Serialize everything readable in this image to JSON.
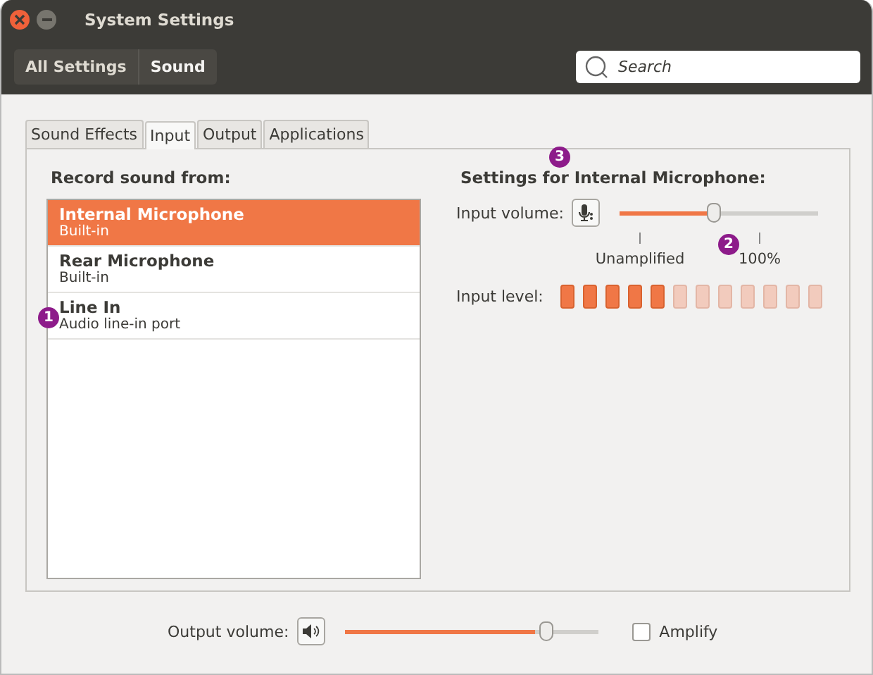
{
  "window": {
    "title": "System Settings"
  },
  "breadcrumbs": [
    {
      "label": "All Settings",
      "selected": false
    },
    {
      "label": "Sound",
      "selected": true
    }
  ],
  "search": {
    "placeholder": "Search"
  },
  "tabs": [
    {
      "label": "Sound Effects",
      "selected": false
    },
    {
      "label": "Input",
      "selected": true
    },
    {
      "label": "Output",
      "selected": false
    },
    {
      "label": "Applications",
      "selected": false
    }
  ],
  "devices": {
    "heading": "Record sound from:",
    "items": [
      {
        "name": "Internal Microphone",
        "detail": "Built-in",
        "selected": true
      },
      {
        "name": "Rear Microphone",
        "detail": "Built-in",
        "selected": false
      },
      {
        "name": "Line In",
        "detail": "Audio line-in port",
        "selected": false
      }
    ]
  },
  "settings": {
    "heading": "Settings for Internal Microphone:",
    "input_volume": {
      "label": "Input volume:",
      "level": 0.44,
      "ticks": [
        "Unamplified",
        "100%"
      ]
    },
    "input_level": {
      "label": "Input level:",
      "level": 0.42
    }
  },
  "output": {
    "label": "Output volume:",
    "level": 0.75,
    "amplify": {
      "label": "Amplify",
      "checked": false
    }
  },
  "callouts": [
    {
      "label": "1"
    },
    {
      "label": "2"
    },
    {
      "label": "3"
    }
  ]
}
